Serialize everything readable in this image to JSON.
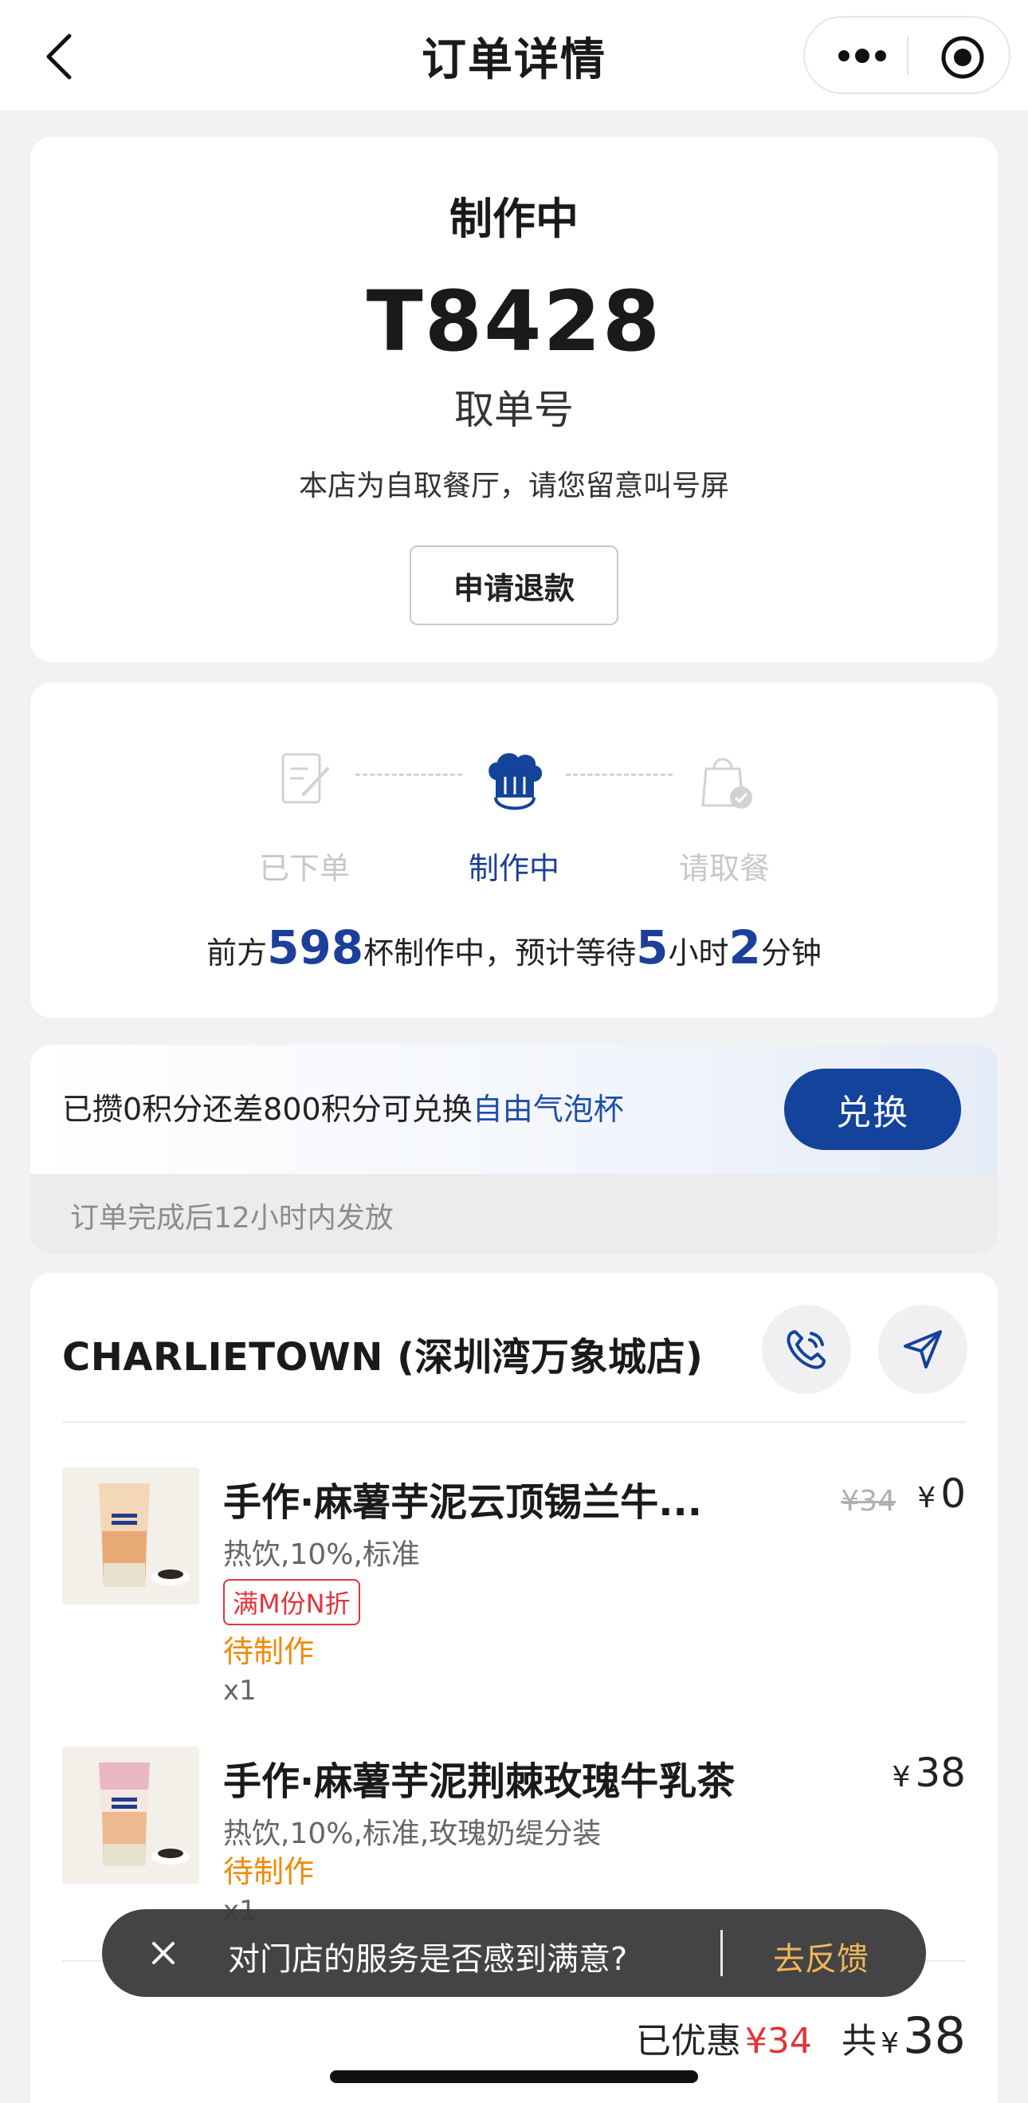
{
  "nav": {
    "title": "订单详情",
    "back_icon": "chevron-left-icon",
    "more_icon": "more-dots-icon",
    "close_icon": "target-circle-icon"
  },
  "status": {
    "title": "制作中",
    "order_number": "T8428",
    "order_number_label": "取单号",
    "hint": "本店为自取餐厅，请您留意叫号屏",
    "refund_label": "申请退款"
  },
  "progress": {
    "steps": [
      {
        "label": "已下单",
        "icon": "order-placed-icon",
        "active": false
      },
      {
        "label": "制作中",
        "icon": "chef-hat-icon",
        "active": true
      },
      {
        "label": "请取餐",
        "icon": "pickup-bag-icon",
        "active": false
      }
    ],
    "queue_prefix": "前方",
    "queue_count": "598",
    "queue_mid": "杯制作中，预计等待",
    "wait_hours": "5",
    "hours_unit": "小时",
    "wait_minutes": "2",
    "minutes_unit": "分钟"
  },
  "points": {
    "text_prefix": "已攒0积分还差800积分可兑换",
    "reward": "自由气泡杯",
    "redeem_label": "兑换",
    "note": "订单完成后12小时内发放"
  },
  "store": {
    "name": "CHARLIETOWN (深圳湾万象城店)",
    "call_icon": "phone-call-icon",
    "navigate_icon": "navigation-arrow-icon"
  },
  "items": [
    {
      "name": "手作·麻薯芋泥云顶锡兰牛...",
      "spec": "热饮,10%,标准",
      "tag": "满M份N折",
      "status": "待制作",
      "qty": "x1",
      "original_price": "¥34",
      "currency": "¥",
      "price": "0"
    },
    {
      "name": "手作·麻薯芋泥荆棘玫瑰牛乳茶",
      "spec": "热饮,10%,标准,玫瑰奶缇分装",
      "status": "待制作",
      "qty": "x1",
      "currency": "¥",
      "price": "38"
    }
  ],
  "summary": {
    "discount_label": "已优惠",
    "discount_value": "¥34",
    "total_label": "共",
    "total_currency": "¥",
    "total_value": "38"
  },
  "toast": {
    "text": "对门店的服务是否感到满意?",
    "action": "去反馈",
    "close_icon": "close-icon"
  },
  "colors": {
    "brand_blue": "#13439a",
    "highlight_blue": "#1b4ea8",
    "status_orange": "#f08a0b",
    "discount_red": "#e0343c"
  }
}
